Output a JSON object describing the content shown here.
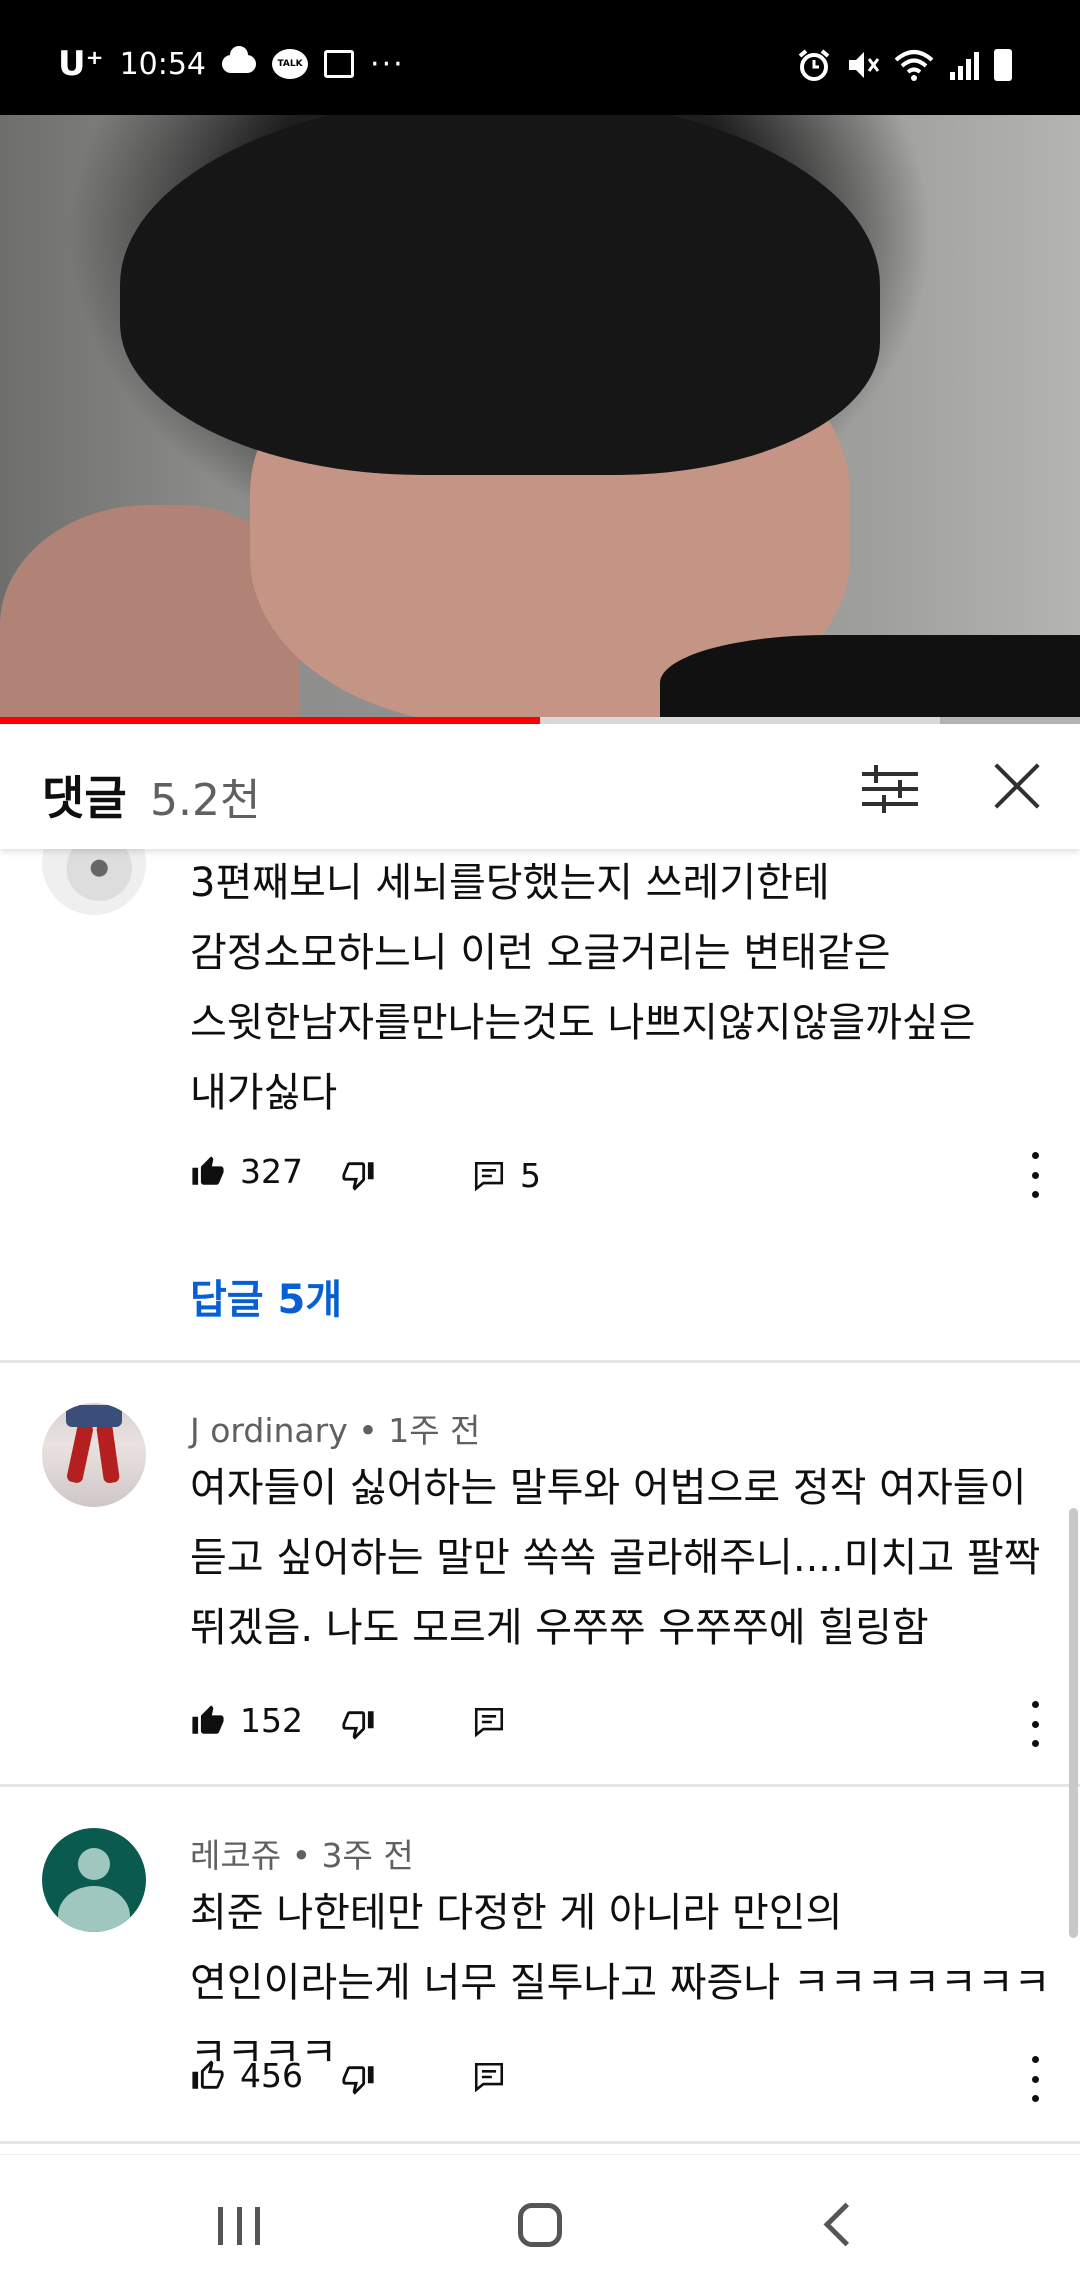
{
  "status_bar": {
    "carrier": "U⁺",
    "time": "10:54",
    "talk_badge": "TALK",
    "more_dots": "···"
  },
  "video": {
    "progress_fraction": 0.5,
    "buffer_fraction": 0.87,
    "colors": {
      "progress": "#ff0000"
    }
  },
  "comments_header": {
    "title": "댓글",
    "count": "5.2천"
  },
  "comments": [
    {
      "lines": [
        "3편째보니 세뇌를당했는지 쓰레기한테",
        "감정소모하느니 이런 오글거리는 변태같은",
        "스윗한남자를만나는것도 나쁘지않지않을까싶은",
        "내가싫다"
      ],
      "likes": "327",
      "replies_count": "5",
      "replies_link": "답글 5개"
    },
    {
      "author": "J ordinary",
      "time": "1주 전",
      "lines": [
        "여자들이 싫어하는 말투와 어법으로 정작 여자들이",
        "듣고 싶어하는 말만 쏙쏙 골라해주니....미치고 팔짝",
        "뛰겠음.  나도 모르게 우쭈쭈 우쭈쭈에 힐링함"
      ],
      "likes": "152"
    },
    {
      "author": "레코쥬",
      "time": "3주 전",
      "lines": [
        "최준 나한테만 다정한 게 아니라 만인의",
        "연인이라는게 너무 질투나고 짜증나 ㅋㅋㅋㅋㅋㅋㅋㅋㅋㅋㅋ"
      ],
      "likes": "456"
    }
  ],
  "meta_separator": " • ",
  "accent_link_color": "#065fd4"
}
